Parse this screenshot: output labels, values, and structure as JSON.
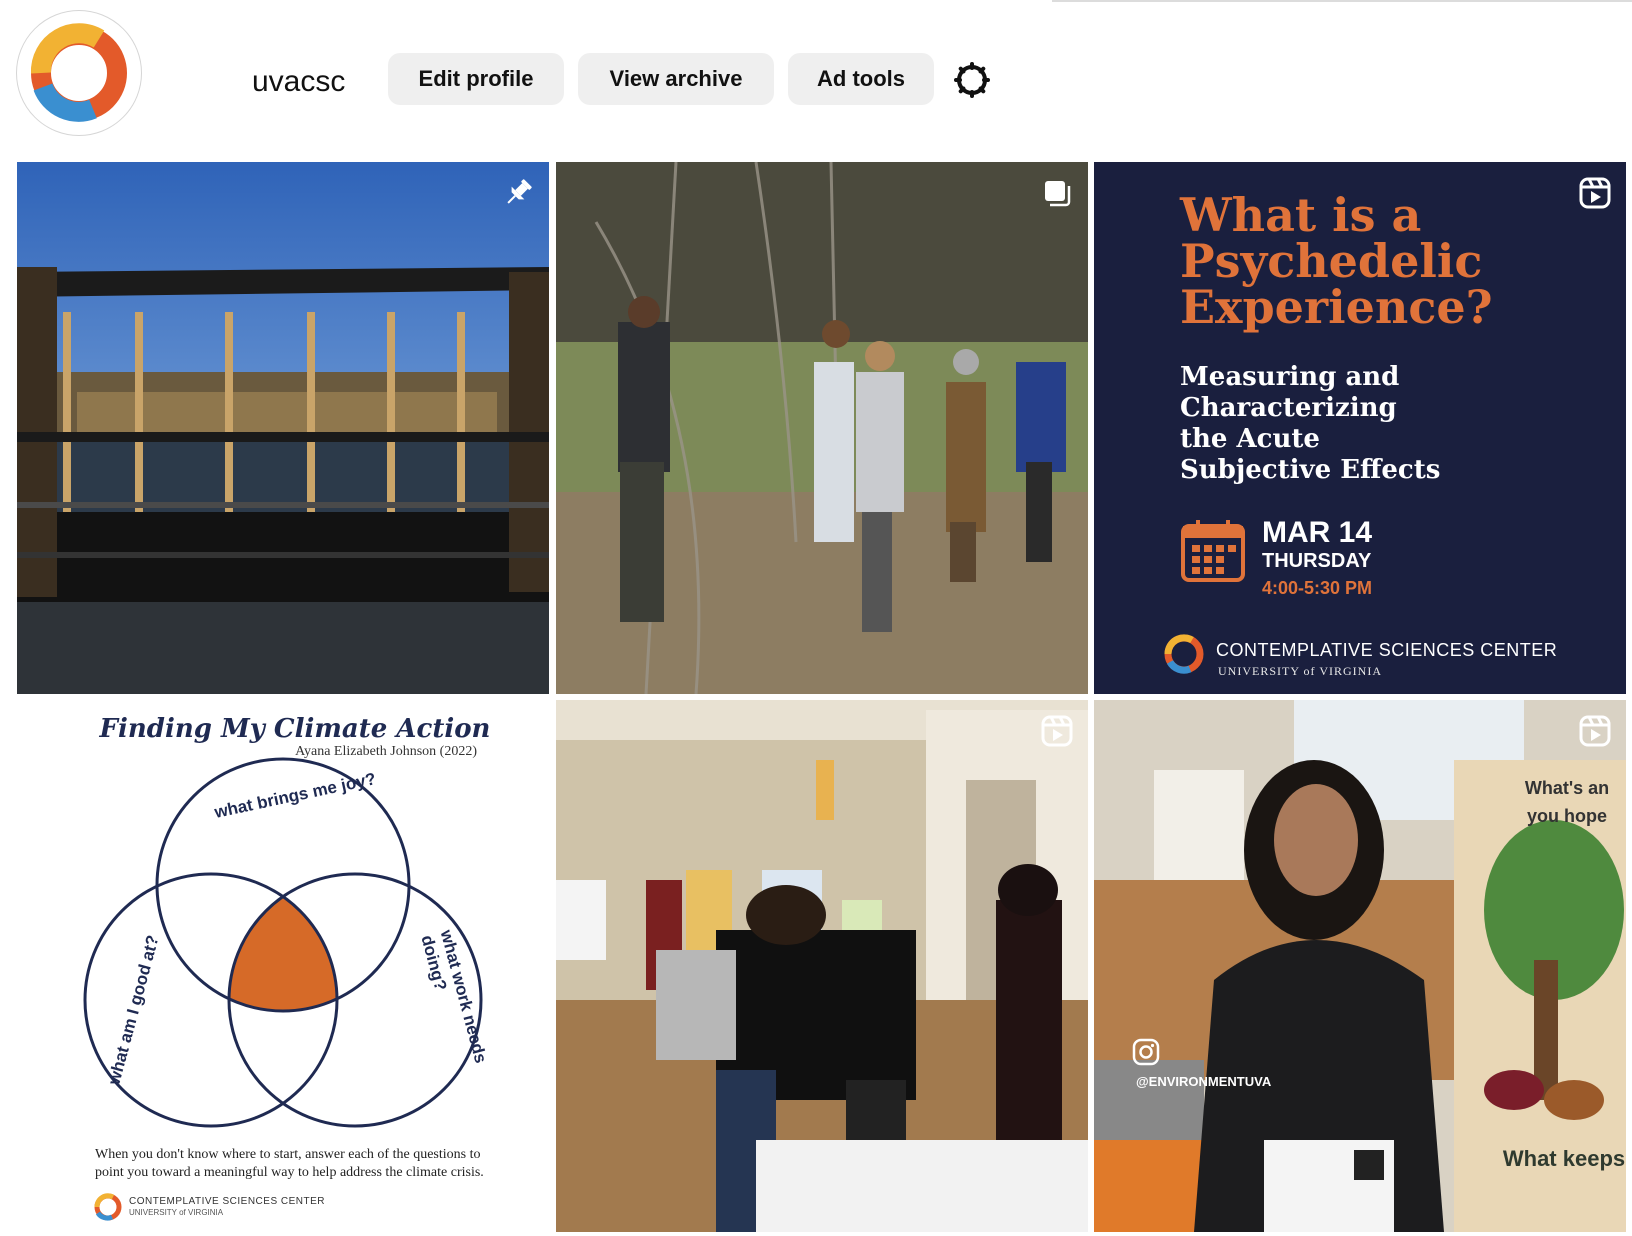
{
  "profile": {
    "username": "uvacsc",
    "avatar_icon": "csc-ring-logo",
    "buttons": {
      "edit_profile": "Edit profile",
      "view_archive": "View archive",
      "ad_tools": "Ad tools"
    },
    "settings_icon": "gear-icon"
  },
  "colors": {
    "button_bg": "#efefef",
    "poster_bg": "#1a1f3e",
    "accent_orange": "#e0733a"
  },
  "grid": {
    "posts": [
      {
        "kind": "photo",
        "subject": "wooden pavilion overlooking a pond",
        "badge": "pin-icon"
      },
      {
        "kind": "photo",
        "subject": "people photographing trees in a forest",
        "badge": "carousel-icon"
      },
      {
        "kind": "poster",
        "badge": "reel-icon",
        "title": "What is a Psychedelic Experience?",
        "subtitle_lines": [
          "Measuring and",
          "Characterizing",
          "the Acute",
          "Subjective Effects"
        ],
        "date": "MAR 14",
        "day": "THURSDAY",
        "time": "4:00-5:30 PM",
        "org": "CONTEMPLATIVE SCIENCES CENTER",
        "university": "UNIVERSITY of VIRGINIA"
      },
      {
        "kind": "venn",
        "title": "Finding My Climate Action",
        "author": "Ayana Elizabeth Johnson (2022)",
        "circles": [
          "what brings me joy?",
          "what am I good at?",
          "what work needs doing?"
        ],
        "caption": "When you don't know where to start, answer each of the questions to point you toward a meaningful way to help address the climate crisis.",
        "org": "CONTEMPLATIVE SCIENCES CENTER",
        "university": "UNIVERSITY of VIRGINIA"
      },
      {
        "kind": "photo",
        "subject": "students at an event table in a hall",
        "badge": "reel-icon"
      },
      {
        "kind": "photo",
        "subject": "student smiling at a climate event",
        "badge": "reel-icon",
        "handle": "@ENVIRONMENTUVA",
        "sign_top": "What's an you hope",
        "sign_bottom": "What keeps"
      }
    ]
  }
}
